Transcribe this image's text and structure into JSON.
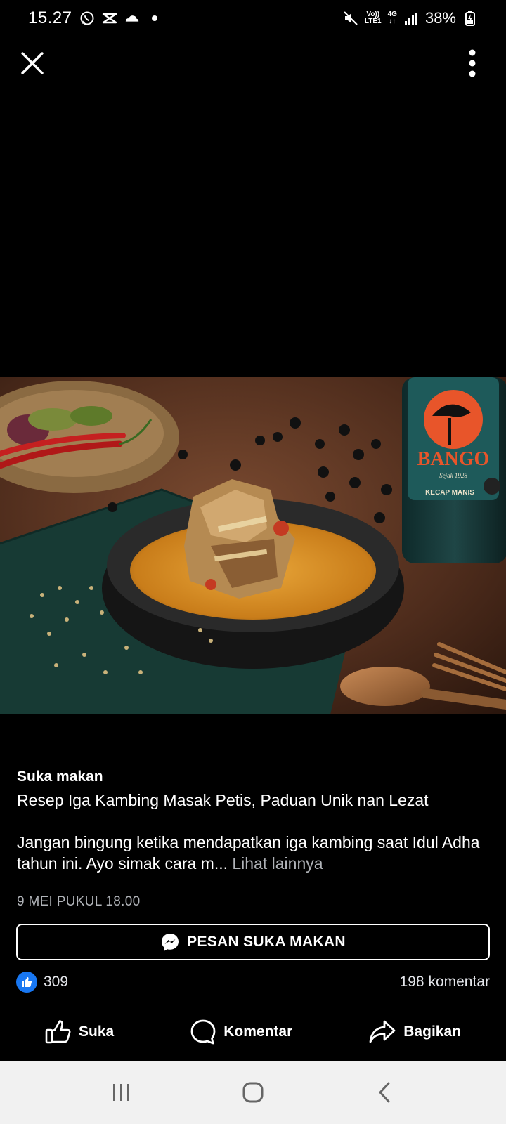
{
  "status_bar": {
    "time": "15.27",
    "network_top": "Vo))",
    "network_bottom": "LTE1",
    "network_type": "4G",
    "battery": "38%",
    "icons": [
      "whatsapp-icon",
      "capcut-icon",
      "cloud-icon",
      "dot-icon",
      "mute-icon",
      "signal-icon",
      "battery-icon"
    ]
  },
  "viewer": {
    "close_icon": "close-icon",
    "more_icon": "more-vertical-icon"
  },
  "photo": {
    "alt_subject": "photo",
    "bottle_brand": "BANGO",
    "bottle_sub": "Sejak 1928",
    "bottle_label": "KECAP MANIS"
  },
  "post": {
    "page_name": "Suka makan",
    "title": "Resep Iga Kambing Masak Petis, Paduan Unik nan Lezat",
    "body": "Jangan bingung ketika mendapatkan iga kambing saat Idul Adha tahun ini. Ayo simak cara m...",
    "see_more": "Lihat lainnya",
    "date": "9 MEI PUKUL 18.00"
  },
  "message_button": {
    "label": "PESAN SUKA MAKAN",
    "icon": "messenger-icon"
  },
  "reactions": {
    "count": "309",
    "comments": "198 komentar"
  },
  "actions": {
    "like": "Suka",
    "comment": "Komentar",
    "share": "Bagikan"
  },
  "colors": {
    "accent": "#1877f2",
    "background": "#000000",
    "muted_text": "#b0b3b8",
    "nav_bar": "#f1f1f1"
  }
}
